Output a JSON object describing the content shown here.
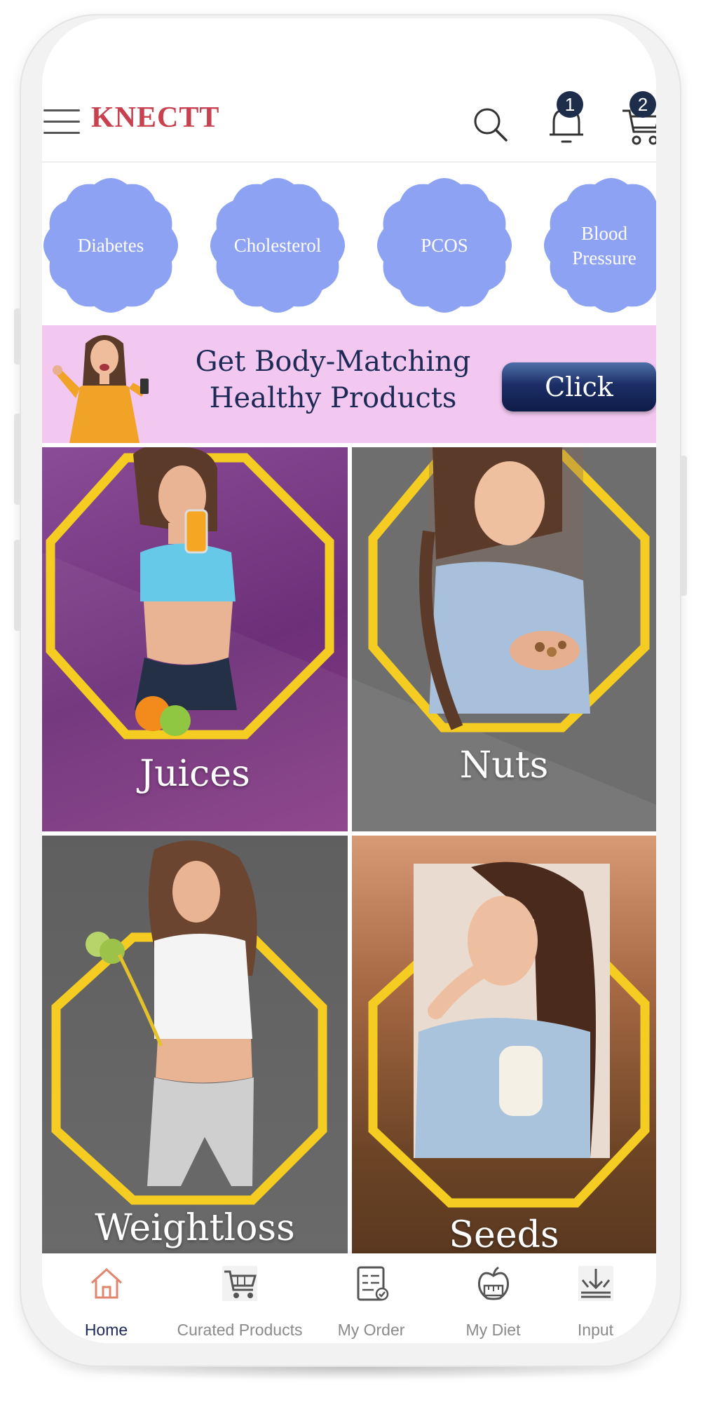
{
  "app": {
    "brand": "KNECTT"
  },
  "header": {
    "notifications_count": "1",
    "cart_count": "2"
  },
  "categories": [
    {
      "label": "Diabetes"
    },
    {
      "label": "Cholesterol"
    },
    {
      "label": "PCOS"
    },
    {
      "label": "Blood Pressure"
    }
  ],
  "promo": {
    "line1": "Get Body-Matching",
    "line2": "Healthy Products",
    "button": "Click"
  },
  "tiles": [
    {
      "label": "Juices"
    },
    {
      "label": "Nuts"
    },
    {
      "label": "Weightloss"
    },
    {
      "label": "Seeds"
    }
  ],
  "bottom_nav": [
    {
      "label": "Home",
      "icon": "home-icon",
      "active": true
    },
    {
      "label": "Curated Products",
      "icon": "cart-icon",
      "active": false
    },
    {
      "label": "My Order",
      "icon": "order-list-icon",
      "active": false
    },
    {
      "label": "My Diet",
      "icon": "diet-apple-icon",
      "active": false
    },
    {
      "label": "Input",
      "icon": "input-download-icon",
      "active": false
    }
  ],
  "colors": {
    "brand": "#c8414f",
    "badge": "#1e2d4a",
    "category_bg": "#8ea2f3",
    "promo_bg": "#f2c8f0",
    "octagon": "#f5cd22",
    "nav_active": "#1d2a55"
  }
}
